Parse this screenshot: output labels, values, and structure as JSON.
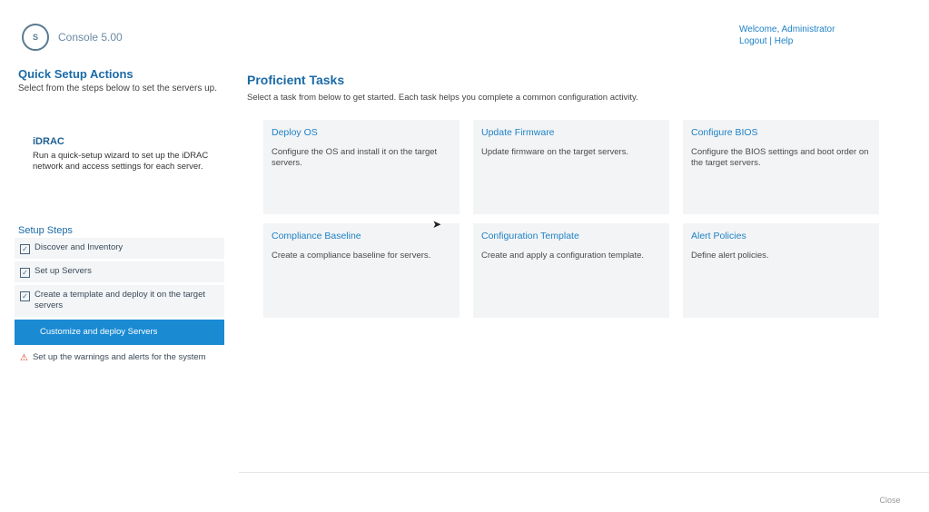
{
  "brand": {
    "badge": "S",
    "name": "Console 5.00"
  },
  "task": {
    "heading": "Quick Setup Actions",
    "subtitle": "Select from the steps below to set the servers up."
  },
  "info": {
    "title": "iDRAC",
    "text": "Run a quick-setup wizard to set up the iDRAC network and access settings for each server."
  },
  "steps_title": "Setup Steps",
  "steps": [
    {
      "label": "Discover and Inventory",
      "state": "done"
    },
    {
      "label": "Set up Servers",
      "state": "done"
    },
    {
      "label": "Create a template and deploy it on the target servers",
      "state": "done"
    },
    {
      "label": "Customize and deploy Servers",
      "state": "active"
    },
    {
      "label": "Set up the warnings and alerts for the system",
      "state": "warn"
    }
  ],
  "top_right": {
    "line1": "Welcome, Administrator",
    "line2": "Logout | Help"
  },
  "main": {
    "title": "Proficient Tasks",
    "description": "Select a task from below to get started. Each task helps you complete a common configuration activity.",
    "cards": [
      {
        "title": "Deploy OS",
        "text": "Configure the OS and install it on the target servers."
      },
      {
        "title": "Update Firmware",
        "text": "Update firmware on the target servers."
      },
      {
        "title": "Configure BIOS",
        "text": "Configure the BIOS settings and boot order on the target servers."
      },
      {
        "title": "Compliance Baseline",
        "text": "Create a compliance baseline for servers."
      },
      {
        "title": "Configuration Template",
        "text": "Create and apply a configuration template."
      },
      {
        "title": "Alert Policies",
        "text": "Define alert policies."
      }
    ]
  },
  "footer": {
    "button": "Close"
  }
}
